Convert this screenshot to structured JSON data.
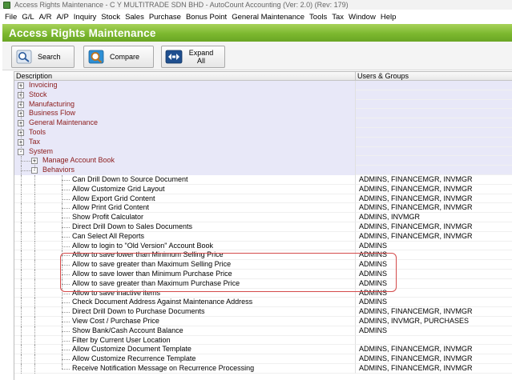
{
  "window": {
    "title": "Access Rights Maintenance - C Y MULTITRADE SDN BHD - AutoCount Accounting (Ver: 2.0) (Rev: 179)"
  },
  "menu": [
    "File",
    "G/L",
    "A/R",
    "A/P",
    "Inquiry",
    "Stock",
    "Sales",
    "Purchase",
    "Bonus Point",
    "General Maintenance",
    "Tools",
    "Tax",
    "Window",
    "Help"
  ],
  "banner": {
    "title": "Access Rights Maintenance"
  },
  "toolbar": {
    "search_label": "Search",
    "compare_label": "Compare",
    "expand_label": "Expand All",
    "icons": {
      "search": "magnifier-icon",
      "compare": "compare-icon",
      "expand": "expand-all-icon"
    }
  },
  "columns": {
    "description": "Description",
    "users": "Users & Groups"
  },
  "tree": [
    {
      "label": "Invoicing",
      "level": 0,
      "expander": "+"
    },
    {
      "label": "Stock",
      "level": 0,
      "expander": "+"
    },
    {
      "label": "Manufacturing",
      "level": 0,
      "expander": "+"
    },
    {
      "label": "Business Flow",
      "level": 0,
      "expander": "+"
    },
    {
      "label": "General Maintenance",
      "level": 0,
      "expander": "+"
    },
    {
      "label": "Tools",
      "level": 0,
      "expander": "+"
    },
    {
      "label": "Tax",
      "level": 0,
      "expander": "+"
    },
    {
      "label": "System",
      "level": 0,
      "expander": "-"
    },
    {
      "label": "Manage Account Book",
      "level": 1,
      "expander": "+"
    },
    {
      "label": "Behaviors",
      "level": 1,
      "expander": "-"
    }
  ],
  "items": [
    {
      "label": "Can Drill Down to Source Document",
      "users": "ADMINS, FINANCEMGR, INVMGR"
    },
    {
      "label": "Allow Customize Grid Layout",
      "users": "ADMINS, FINANCEMGR, INVMGR"
    },
    {
      "label": "Allow Export Grid Content",
      "users": "ADMINS, FINANCEMGR, INVMGR"
    },
    {
      "label": "Allow Print Grid Content",
      "users": "ADMINS, FINANCEMGR, INVMGR"
    },
    {
      "label": "Show Profit Calculator",
      "users": "ADMINS, INVMGR"
    },
    {
      "label": "Direct Drill Down to Sales Documents",
      "users": "ADMINS, FINANCEMGR, INVMGR"
    },
    {
      "label": "Can Select All Reports",
      "users": "ADMINS, FINANCEMGR, INVMGR"
    },
    {
      "label": "Allow to login to \"Old Version\" Account Book",
      "users": "ADMINS"
    },
    {
      "label": "Allow to save lower than Minimum Selling Price",
      "users": "ADMINS"
    },
    {
      "label": "Allow to save greater than Maximum Selling Price",
      "users": "ADMINS"
    },
    {
      "label": "Allow to save lower than Minimum Purchase Price",
      "users": "ADMINS"
    },
    {
      "label": "Allow to save greater than Maximum Purchase Price",
      "users": "ADMINS"
    },
    {
      "label": "Allow to save inactive items",
      "users": "ADMINS"
    },
    {
      "label": "Check Document Address Against Maintenance Address",
      "users": "ADMINS"
    },
    {
      "label": "Direct Drill Down to Purchase Documents",
      "users": "ADMINS, FINANCEMGR, INVMGR"
    },
    {
      "label": "View Cost / Purchase Price",
      "users": "ADMINS, INVMGR, PURCHASES"
    },
    {
      "label": "Show Bank/Cash Account Balance",
      "users": "ADMINS"
    },
    {
      "label": "Filter by Current User Location",
      "users": ""
    },
    {
      "label": "Allow Customize Document Template",
      "users": "ADMINS, FINANCEMGR, INVMGR"
    },
    {
      "label": "Allow Customize Recurrence Template",
      "users": "ADMINS, FINANCEMGR, INVMGR"
    },
    {
      "label": "Receive Notification Message on Recurrence Processing",
      "users": "ADMINS, FINANCEMGR, INVMGR"
    }
  ],
  "colors": {
    "banner": "#7cb82f",
    "category_text": "#8b1a1a",
    "category_bg": "#e8e8f8",
    "highlight": "#d44a4a"
  }
}
